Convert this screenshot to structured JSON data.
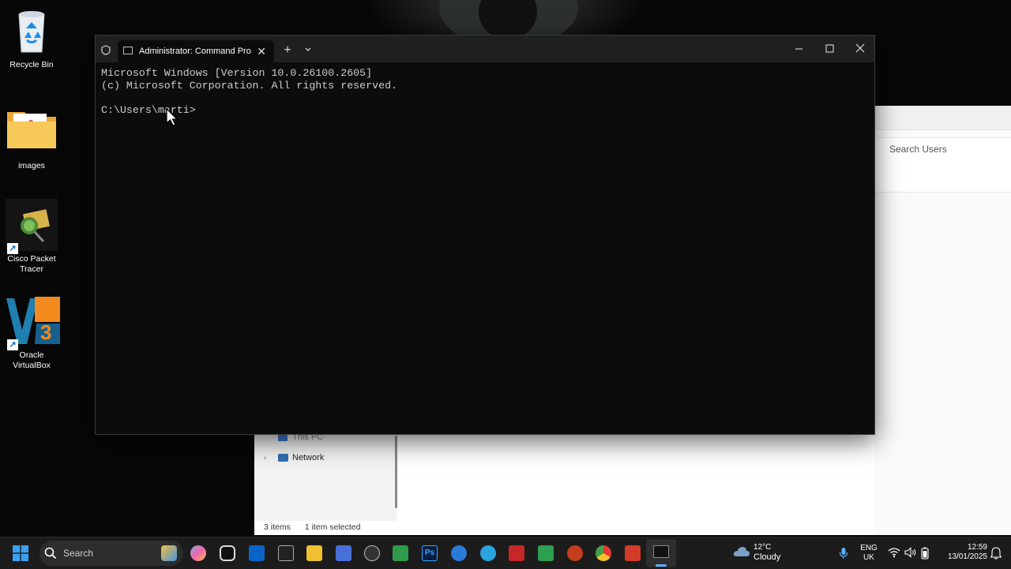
{
  "desktop": {
    "icons": [
      {
        "label": "Recycle Bin"
      },
      {
        "label": "images"
      },
      {
        "label": "Cisco Packet Tracer"
      },
      {
        "label": "Oracle VirtualBox"
      }
    ]
  },
  "explorer": {
    "search_placeholder": "Search Users",
    "nav": [
      {
        "label": "This PC"
      },
      {
        "label": "Network"
      }
    ],
    "status": {
      "items": "3 items",
      "selected": "1 item selected"
    }
  },
  "terminal": {
    "tab_title": "Administrator: Command Pro",
    "lines": [
      "Microsoft Windows [Version 10.0.26100.2605]",
      "(c) Microsoft Corporation. All rights reserved.",
      "",
      "C:\\Users\\marti>"
    ]
  },
  "taskbar": {
    "search_label": "Search",
    "weather": {
      "temp": "12°C",
      "condition": "Cloudy"
    },
    "language": {
      "lang": "ENG",
      "region": "UK"
    },
    "clock": {
      "time": "12:59",
      "date": "13/01/2025"
    }
  },
  "colors": {
    "terminal_bg": "#0c0c0c",
    "titlebar_bg": "#202020",
    "taskbar_bg": "#1c1c1c",
    "console_text": "#cccccc"
  }
}
